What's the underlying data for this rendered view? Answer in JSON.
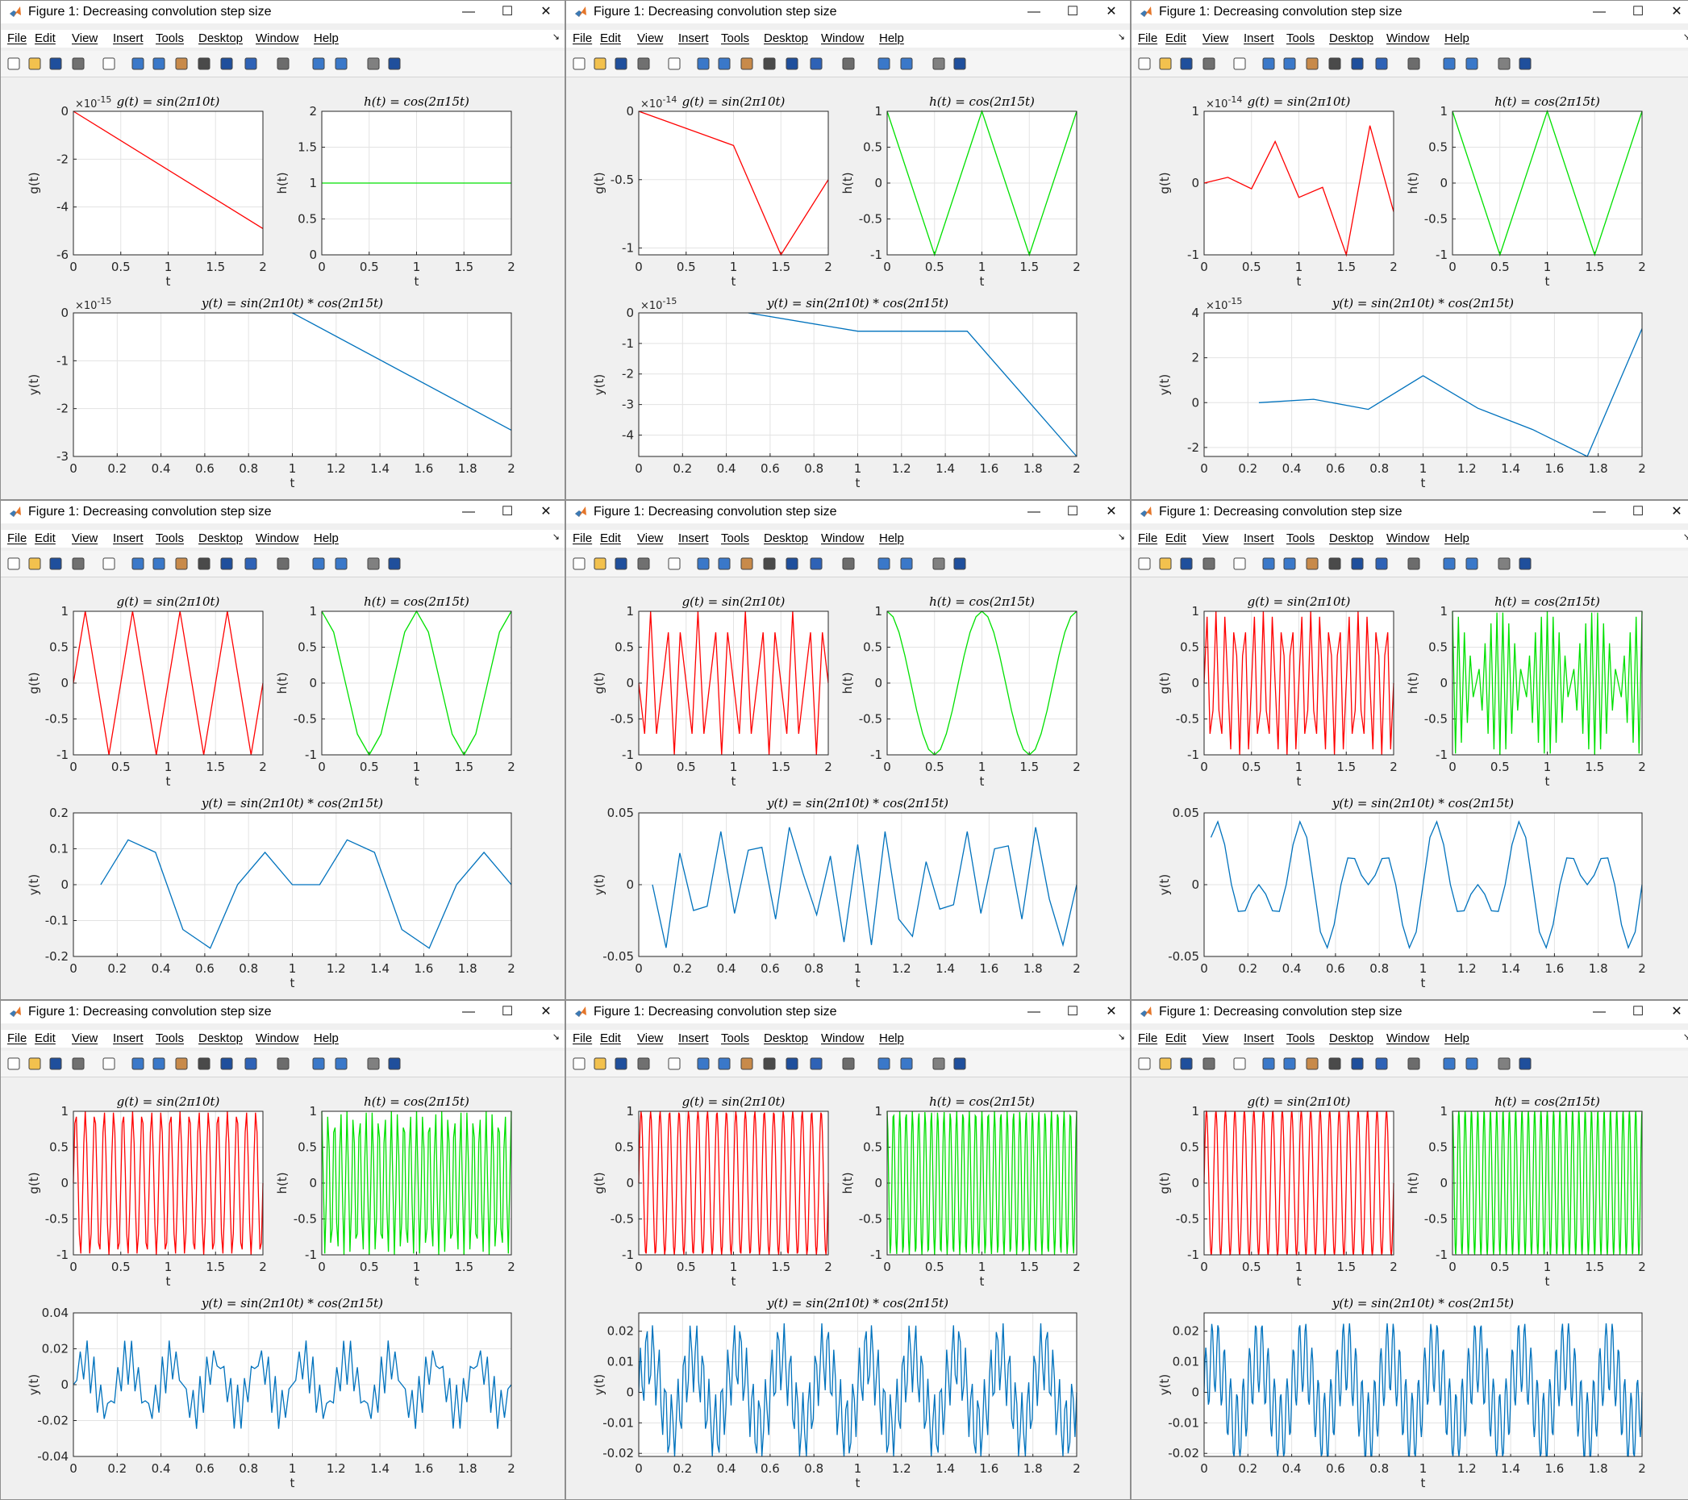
{
  "window": {
    "title": "Figure 1: Decreasing convolution step size",
    "controls": [
      "—",
      "☐",
      "✕"
    ]
  },
  "menu": [
    "File",
    "Edit",
    "View",
    "Insert",
    "Tools",
    "Desktop",
    "Window",
    "Help"
  ],
  "toolbar_icons": [
    "new-figure-icon",
    "open-file-icon",
    "save-icon",
    "print-icon",
    "pointer-icon",
    "zoom-in-icon",
    "zoom-out-icon",
    "pan-icon",
    "rotate-3d-icon",
    "data-cursor-icon",
    "brush-icon",
    "link-icon",
    "colorbar-icon",
    "legend-icon",
    "hide-plot-tools-icon",
    "show-plot-tools-icon"
  ],
  "colors": {
    "g": "#ff0000",
    "h": "#00e000",
    "y": "#0072bd",
    "bg": "#f0f0f0"
  },
  "subplot_titles": {
    "g": "g(t) = sin(2π10t)",
    "h": "h(t) = cos(2π15t)",
    "y": "y(t) = sin(2π10t) * cos(2π15t)"
  },
  "axis_labels": {
    "x": "t",
    "g": "g(t)",
    "h": "h(t)",
    "y": "y(t)"
  },
  "chart_data": [
    {
      "type": "line",
      "panel": 1,
      "t_step": 0.5,
      "grid": true,
      "g": {
        "title": "g(t) = sin(2π10t)",
        "ylabel": "g(t)",
        "xlabel": "t",
        "exponent": "×10^-15",
        "xlim": [
          0,
          2
        ],
        "ylim": [
          -6,
          0
        ],
        "yticks": [
          "0",
          "-2",
          "-4",
          "-6"
        ],
        "x": [
          0,
          2
        ],
        "values": [
          0,
          -4.9
        ]
      },
      "h": {
        "title": "h(t) = cos(2π15t)",
        "ylabel": "h(t)",
        "xlabel": "t",
        "xlim": [
          0,
          2
        ],
        "ylim": [
          0,
          2
        ],
        "yticks": [
          "2",
          "1.5",
          "1",
          "0.5",
          "0"
        ],
        "x": [
          0,
          2
        ],
        "values": [
          1,
          1
        ]
      },
      "y": {
        "title": "y(t) = sin(2π10t) * cos(2π15t)",
        "ylabel": "y(t)",
        "xlabel": "t",
        "exponent": "×10^-15",
        "xlim": [
          0,
          2
        ],
        "ylim": [
          -3,
          0
        ],
        "yticks": [
          "0",
          "-1",
          "-2",
          "-3"
        ],
        "x": [
          1,
          2
        ],
        "values": [
          0,
          -2.45
        ]
      }
    },
    {
      "type": "line",
      "panel": 2,
      "t_step": 0.25,
      "grid": true,
      "g": {
        "title": "g(t) = sin(2π10t)",
        "ylabel": "g(t)",
        "xlabel": "t",
        "exponent": "×10^-14",
        "xlim": [
          0,
          2
        ],
        "ylim": [
          -1.05,
          0
        ],
        "yticks": [
          "0",
          "-0.5",
          "-1"
        ],
        "x": [
          0,
          1,
          1.5,
          2
        ],
        "values": [
          0,
          -0.25,
          -1.05,
          -0.5
        ]
      },
      "h": {
        "title": "h(t) = cos(2π15t)",
        "ylabel": "h(t)",
        "xlabel": "t",
        "xlim": [
          0,
          2
        ],
        "ylim": [
          -1,
          1
        ],
        "yticks": [
          "1",
          "0.5",
          "0",
          "-0.5",
          "-1"
        ],
        "x": [
          0,
          0.5,
          1,
          1.5,
          2
        ],
        "values": [
          1,
          -1,
          1,
          -1,
          1
        ]
      },
      "y": {
        "title": "y(t) = sin(2π10t) * cos(2π15t)",
        "ylabel": "y(t)",
        "xlabel": "t",
        "exponent": "×10^-15",
        "xlim": [
          0,
          2
        ],
        "ylim": [
          -4.7,
          0
        ],
        "yticks": [
          "0",
          "-1",
          "-2",
          "-3",
          "-4"
        ],
        "x": [
          0.5,
          1,
          1.5,
          2
        ],
        "values": [
          0,
          -0.6,
          -0.6,
          -4.7
        ]
      }
    },
    {
      "type": "line",
      "panel": 3,
      "t_step": 0.25,
      "grid": true,
      "g": {
        "title": "g(t) = sin(2π10t)",
        "ylabel": "g(t)",
        "xlabel": "t",
        "exponent": "×10^-14",
        "xlim": [
          0,
          2
        ],
        "ylim": [
          -1,
          1
        ],
        "yticks": [
          "1",
          "0",
          "-1"
        ],
        "x": [
          0,
          0.25,
          0.5,
          0.75,
          1,
          1.25,
          1.5,
          1.75,
          2
        ],
        "values": [
          0,
          0.08,
          -0.08,
          0.58,
          -0.2,
          -0.06,
          -1,
          0.8,
          -0.4
        ]
      },
      "h": {
        "title": "h(t) = cos(2π15t)",
        "ylabel": "h(t)",
        "xlabel": "t",
        "xlim": [
          0,
          2
        ],
        "ylim": [
          -1,
          1
        ],
        "yticks": [
          "1",
          "0.5",
          "0",
          "-0.5",
          "-1"
        ],
        "x": [
          0,
          0.5,
          1,
          1.5,
          2
        ],
        "values": [
          1,
          -1,
          1,
          -1,
          1
        ]
      },
      "y": {
        "title": "y(t) = sin(2π10t) * cos(2π15t)",
        "ylabel": "y(t)",
        "xlabel": "t",
        "exponent": "×10^-15",
        "xlim": [
          0,
          2
        ],
        "ylim": [
          -2.4,
          4
        ],
        "yticks": [
          "4",
          "2",
          "0",
          "-2"
        ],
        "x": [
          0.25,
          0.5,
          0.75,
          1,
          1.25,
          1.5,
          1.75,
          2
        ],
        "values": [
          0,
          0.15,
          -0.3,
          1.2,
          -0.25,
          -1.2,
          -2.4,
          3.3
        ]
      }
    },
    {
      "type": "line",
      "panel": 4,
      "t_step": 0.125,
      "grid": true,
      "g": {
        "title": "g(t) = sin(2π10t)",
        "ylabel": "g(t)",
        "xlabel": "t",
        "xlim": [
          0,
          2
        ],
        "ylim": [
          -1,
          1
        ],
        "yticks": [
          "1",
          "0.5",
          "0",
          "-0.5",
          "-1"
        ],
        "x": [
          0,
          0.125,
          0.375,
          0.625,
          0.875,
          1.125,
          1.375,
          1.625,
          1.875,
          2
        ],
        "values": [
          0,
          1,
          -1,
          1,
          -1,
          1,
          -1,
          1,
          -1,
          0
        ]
      },
      "h": {
        "title": "h(t) = cos(2π15t)",
        "ylabel": "h(t)",
        "xlabel": "t",
        "xlim": [
          0,
          2
        ],
        "ylim": [
          -1,
          1
        ],
        "yticks": [
          "1",
          "0.5",
          "0",
          "-0.5",
          "-1"
        ],
        "x": [
          0,
          0.125,
          0.25,
          0.375,
          0.5,
          0.625,
          0.75,
          0.875,
          1,
          1.125,
          1.25,
          1.375,
          1.5,
          1.625,
          1.75,
          1.875,
          2
        ],
        "values": [
          1,
          0.71,
          0,
          -0.71,
          -1,
          -0.71,
          0,
          0.71,
          1,
          0.71,
          0,
          -0.71,
          -1,
          -0.71,
          0,
          0.71,
          1
        ]
      },
      "y": {
        "title": "y(t) = sin(2π10t) * cos(2π15t)",
        "ylabel": "y(t)",
        "xlabel": "t",
        "xlim": [
          0,
          2
        ],
        "ylim": [
          -0.2,
          0.2
        ],
        "yticks": [
          "0.2",
          "0.1",
          "0",
          "-0.1",
          "-0.2"
        ],
        "x": [
          0.125,
          0.25,
          0.375,
          0.5,
          0.625,
          0.75,
          0.875,
          1,
          1.125,
          1.25,
          1.375,
          1.5,
          1.625,
          1.75,
          1.875,
          2
        ],
        "values": [
          0,
          0.125,
          0.09,
          -0.125,
          -0.177,
          0,
          0.09,
          0,
          0,
          0.125,
          0.09,
          -0.125,
          -0.177,
          0,
          0.09,
          0
        ]
      }
    },
    {
      "type": "line",
      "panel": 5,
      "t_step": 0.0625,
      "grid": true,
      "g": {
        "title": "g(t) = sin(2π10t)",
        "ylabel": "g(t)",
        "xlabel": "t",
        "xlim": [
          0,
          2
        ],
        "ylim": [
          -1,
          1
        ],
        "yticks": [
          "1",
          "0.5",
          "0",
          "-0.5",
          "-1"
        ],
        "fn": "sin",
        "freq": 10,
        "samples": 33
      },
      "h": {
        "title": "h(t) = cos(2π15t)",
        "ylabel": "h(t)",
        "xlabel": "t",
        "xlim": [
          0,
          2
        ],
        "ylim": [
          -1,
          1
        ],
        "yticks": [
          "1",
          "0.5",
          "0",
          "-0.5",
          "-1"
        ],
        "fn": "cos",
        "freq": 15,
        "samples": 33
      },
      "y": {
        "title": "y(t) = sin(2π10t) * cos(2π15t)",
        "ylabel": "y(t)",
        "xlabel": "t",
        "xlim": [
          0,
          2
        ],
        "ylim": [
          -0.05,
          0.05
        ],
        "yticks": [
          "0.05",
          "0",
          "-0.05"
        ],
        "x": [
          0.0625,
          0.125,
          0.1875,
          0.25,
          0.3125,
          0.375,
          0.4375,
          0.5,
          0.5625,
          0.625,
          0.6875,
          0.75,
          0.8125,
          0.875,
          0.9375,
          1,
          1.0625,
          1.125,
          1.1875,
          1.25,
          1.3125,
          1.375,
          1.4375,
          1.5,
          1.5625,
          1.625,
          1.6875,
          1.75,
          1.8125,
          1.875,
          1.9375,
          2
        ],
        "values": [
          0,
          -0.044,
          0.022,
          -0.018,
          -0.015,
          0.037,
          -0.02,
          0.024,
          0.026,
          -0.024,
          0.04,
          0.008,
          -0.021,
          0.02,
          -0.04,
          0.028,
          -0.042,
          0.037,
          -0.024,
          -0.036,
          0.016,
          -0.017,
          -0.014,
          0.037,
          -0.02,
          0.025,
          0.027,
          -0.024,
          0.04,
          -0.01,
          -0.042,
          0
        ]
      }
    },
    {
      "type": "line",
      "panel": 6,
      "t_step": 0.03125,
      "grid": true,
      "g": {
        "title": "g(t) = sin(2π10t)",
        "ylabel": "g(t)",
        "xlabel": "t",
        "xlim": [
          0,
          2
        ],
        "ylim": [
          -1,
          1
        ],
        "yticks": [
          "1",
          "0.5",
          "0",
          "-0.5",
          "-1"
        ],
        "fn": "sin",
        "freq": 10,
        "samples": 65
      },
      "h": {
        "title": "h(t) = cos(2π15t)",
        "ylabel": "h(t)",
        "xlabel": "t",
        "xlim": [
          0,
          2
        ],
        "ylim": [
          -1,
          1
        ],
        "yticks": [
          "1",
          "0.5",
          "0",
          "-0.5",
          "-1"
        ],
        "fn": "cos",
        "freq": 15,
        "samples": 65
      },
      "y": {
        "title": "y(t) = sin(2π10t) * cos(2π15t)",
        "ylabel": "y(t)",
        "xlabel": "t",
        "xlim": [
          0,
          2
        ],
        "ylim": [
          -0.05,
          0.05
        ],
        "yticks": [
          "0.05",
          "0",
          "-0.05"
        ],
        "fn": "product",
        "t_start": 0.03125,
        "samples": 64,
        "amplitude": 0.05
      }
    },
    {
      "type": "line",
      "panel": 7,
      "t_step": 0.015625,
      "grid": true,
      "g": {
        "title": "g(t) = sin(2π10t)",
        "ylabel": "g(t)",
        "xlabel": "t",
        "xlim": [
          0,
          2
        ],
        "ylim": [
          -1,
          1
        ],
        "yticks": [
          "1",
          "0.5",
          "0",
          "-0.5",
          "-1"
        ],
        "fn": "sin",
        "freq": 10,
        "samples": 129
      },
      "h": {
        "title": "h(t) = cos(2π15t)",
        "ylabel": "h(t)",
        "xlabel": "t",
        "xlim": [
          0,
          2
        ],
        "ylim": [
          -1,
          1
        ],
        "yticks": [
          "1",
          "0.5",
          "0",
          "-0.5",
          "-1"
        ],
        "fn": "cos",
        "freq": 15,
        "samples": 129
      },
      "y": {
        "title": "y(t) = sin(2π10t) * cos(2π15t)",
        "ylabel": "y(t)",
        "xlabel": "t",
        "xlim": [
          0,
          2
        ],
        "ylim": [
          -0.04,
          0.04
        ],
        "yticks": [
          "0.04",
          "0.02",
          "0",
          "-0.02",
          "-0.04"
        ],
        "fn": "product",
        "t_start": 0,
        "samples": 129,
        "amplitude": 0.028
      }
    },
    {
      "type": "line",
      "panel": 8,
      "t_step": 0.0078125,
      "grid": true,
      "g": {
        "title": "g(t) = sin(2π10t)",
        "ylabel": "g(t)",
        "xlabel": "t",
        "xlim": [
          0,
          2
        ],
        "ylim": [
          -1,
          1
        ],
        "yticks": [
          "1",
          "0.5",
          "0",
          "-0.5",
          "-1"
        ],
        "fn": "sin",
        "freq": 10,
        "samples": 257
      },
      "h": {
        "title": "h(t) = cos(2π15t)",
        "ylabel": "h(t)",
        "xlabel": "t",
        "xlim": [
          0,
          2
        ],
        "ylim": [
          -1,
          1
        ],
        "yticks": [
          "1",
          "0.5",
          "0",
          "-0.5",
          "-1"
        ],
        "fn": "cos",
        "freq": 15,
        "samples": 257
      },
      "y": {
        "title": "y(t) = sin(2π10t) * cos(2π15t)",
        "ylabel": "y(t)",
        "xlabel": "t",
        "xlim": [
          0,
          2
        ],
        "ylim": [
          -0.021,
          0.026
        ],
        "yticks": [
          "0.02",
          "0.01",
          "0",
          "-0.01",
          "-0.02"
        ],
        "fn": "product",
        "t_start": 0,
        "samples": 257,
        "amplitude": 0.025
      }
    },
    {
      "type": "line",
      "panel": 9,
      "t_step": 0.00390625,
      "grid": true,
      "g": {
        "title": "g(t) = sin(2π10t)",
        "ylabel": "g(t)",
        "xlabel": "t",
        "xlim": [
          0,
          2
        ],
        "ylim": [
          -1,
          1
        ],
        "yticks": [
          "1",
          "0.5",
          "0",
          "-0.5",
          "-1"
        ],
        "fn": "sin",
        "freq": 10,
        "samples": 513
      },
      "h": {
        "title": "h(t) = cos(2π15t)",
        "ylabel": "h(t)",
        "xlabel": "t",
        "xlim": [
          0,
          2
        ],
        "ylim": [
          -1,
          1
        ],
        "yticks": [
          "1",
          "0.5",
          "0",
          "-0.5",
          "-1"
        ],
        "fn": "cos",
        "freq": 15,
        "samples": 513
      },
      "y": {
        "title": "y(t) = sin(2π10t) * cos(2π15t)",
        "ylabel": "y(t)",
        "xlabel": "t",
        "xlim": [
          0,
          2
        ],
        "ylim": [
          -0.021,
          0.026
        ],
        "yticks": [
          "0.02",
          "0.01",
          "0",
          "-0.01",
          "-0.02"
        ],
        "fn": "product",
        "t_start": 0,
        "samples": 513,
        "amplitude": 0.025
      }
    }
  ]
}
